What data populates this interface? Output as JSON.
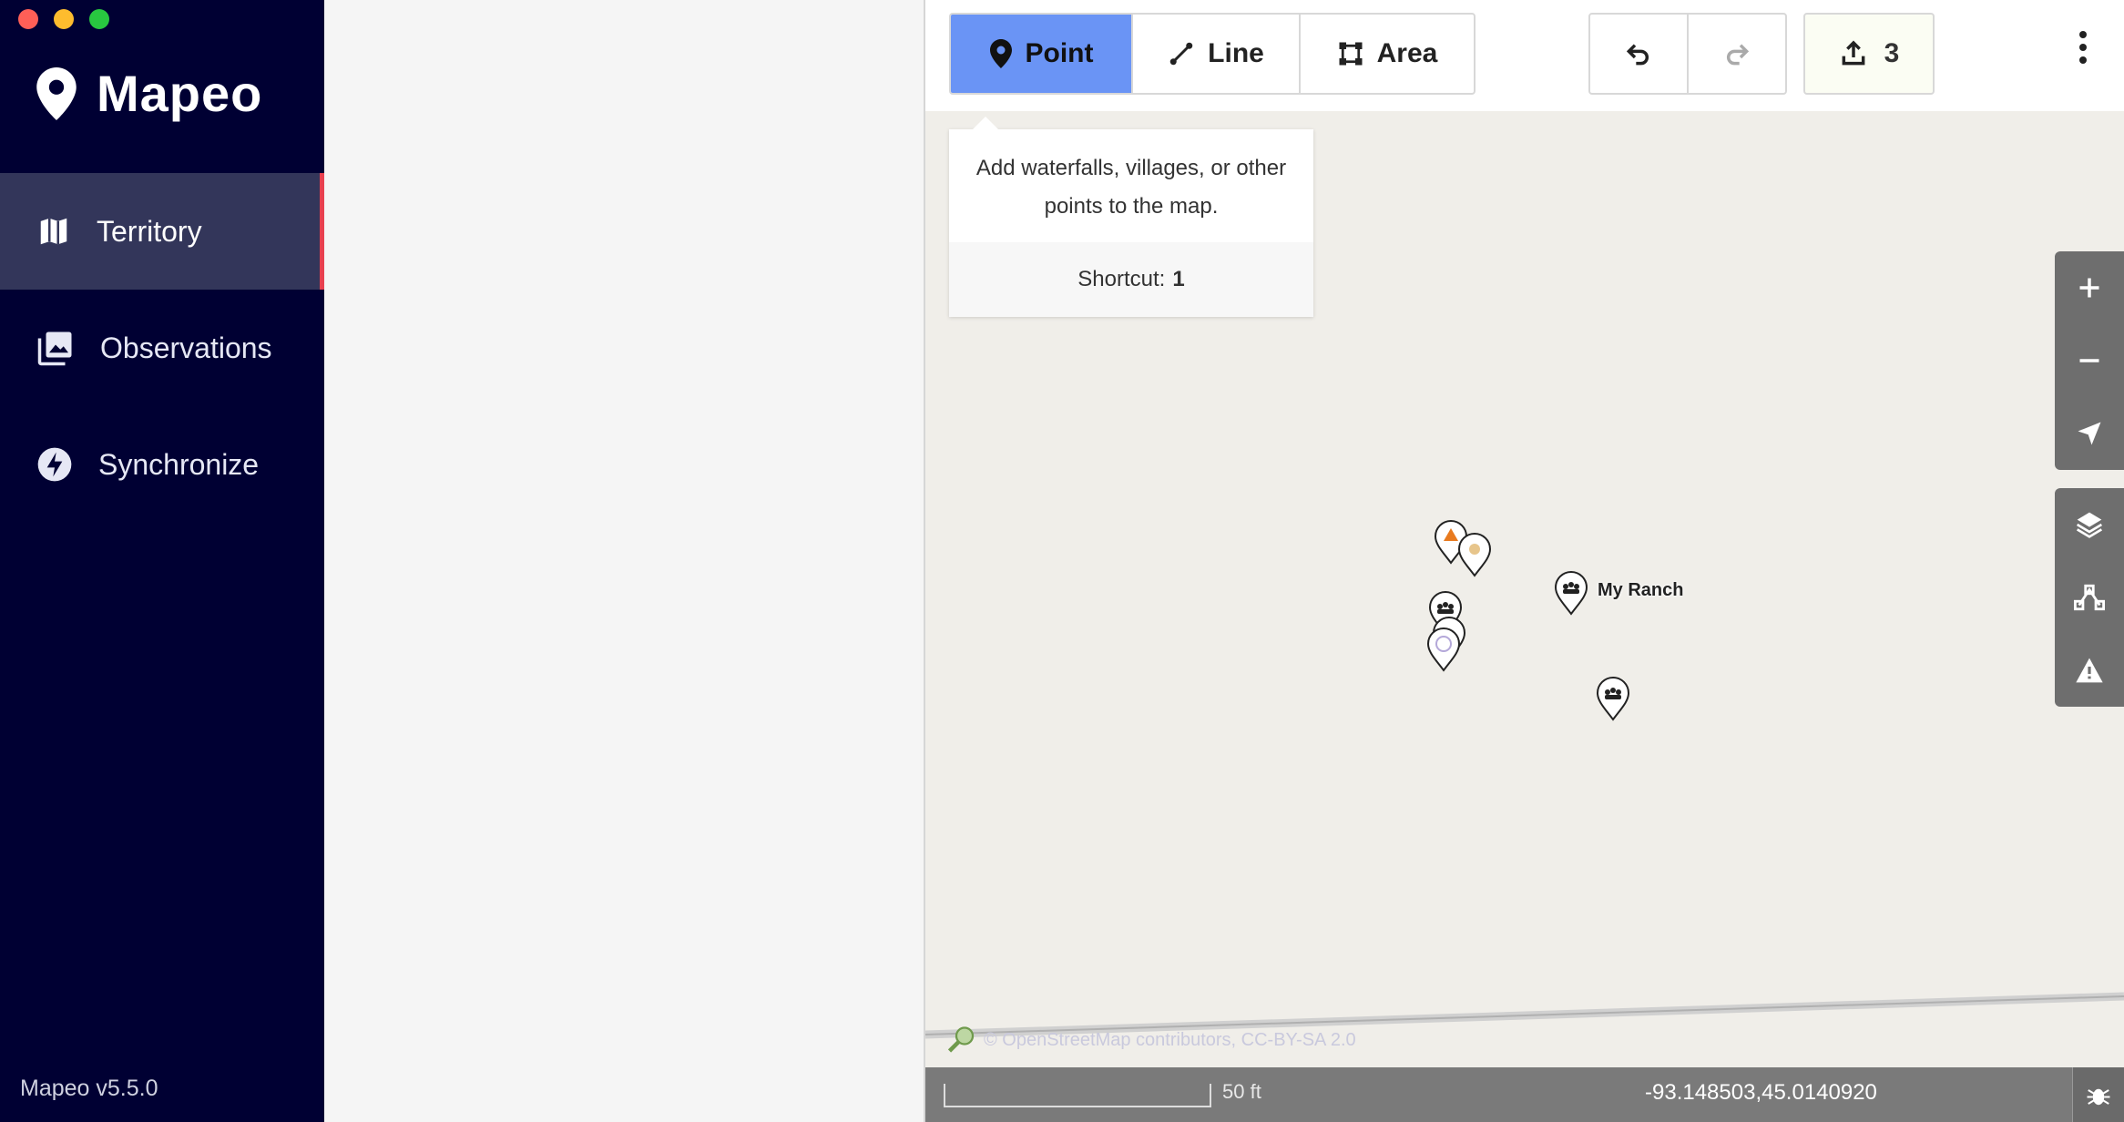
{
  "window": {
    "title": "Mapeo"
  },
  "sidebar": {
    "app_name": "Mapeo",
    "items": [
      {
        "label": "Territory",
        "icon": "map-icon",
        "active": true
      },
      {
        "label": "Observations",
        "icon": "photo-library-icon",
        "active": false
      },
      {
        "label": "Synchronize",
        "icon": "bolt-icon",
        "active": false
      }
    ],
    "version": "Mapeo v5.5.0"
  },
  "toolbar": {
    "modes": [
      {
        "label": "Point",
        "icon": "pin-icon",
        "selected": true
      },
      {
        "label": "Line",
        "icon": "line-icon",
        "selected": false
      },
      {
        "label": "Area",
        "icon": "area-icon",
        "selected": false
      }
    ],
    "upload_count": "3",
    "accent_color": "#6a94f5"
  },
  "tooltip": {
    "text": "Add waterfalls, villages, or other points to the map.",
    "shortcut_label": "Shortcut:",
    "shortcut_key": "1"
  },
  "map": {
    "ranch_label": "My Ranch",
    "attribution": "© OpenStreetMap contributors, CC-BY-SA 2.0",
    "scale": "50 ft",
    "coordinates": "-93.148503,45.0140920"
  }
}
